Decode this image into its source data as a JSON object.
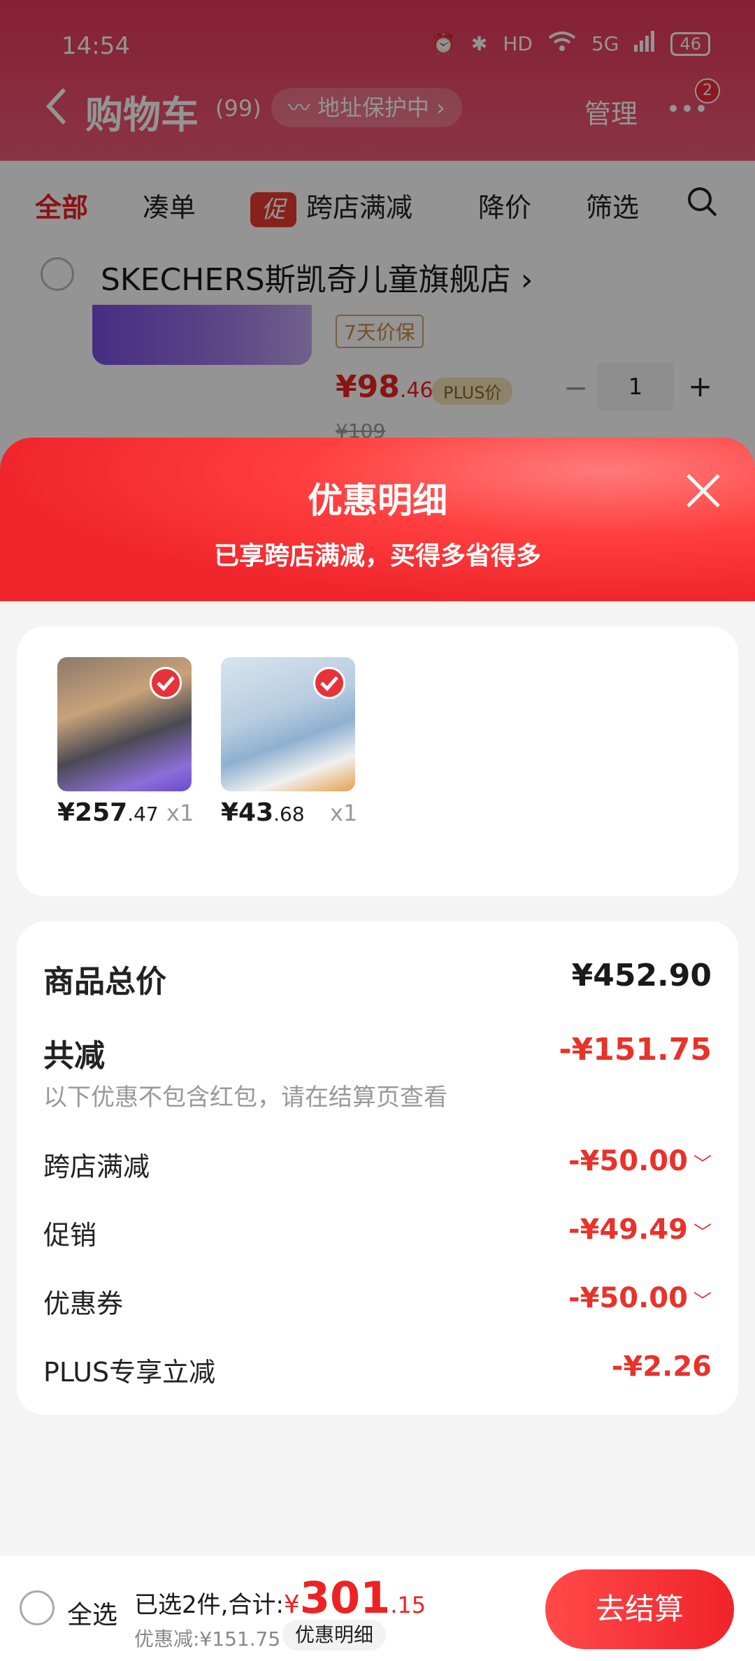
{
  "status_bar": {
    "time": "14:54",
    "battery": "46",
    "network": "5G",
    "hd": "HD"
  },
  "nav": {
    "title": "购物车",
    "count": "(99)",
    "address_pill": "地址保护中",
    "manage": "管理",
    "more_badge": "2"
  },
  "filters": {
    "all": "全部",
    "bundle": "凑单",
    "promo_chip": "促",
    "cross_store": "跨店满减",
    "price_drop": "降价",
    "filter": "筛选"
  },
  "store": {
    "name": "SKECHERS斯凯奇儿童旗舰店",
    "guarantee": "7天价保",
    "price_int": "¥98",
    "price_dec": ".46",
    "plus_tag": "PLUS价",
    "qty": "1",
    "old_price": "¥109"
  },
  "sheet": {
    "title": "优惠明细",
    "subtitle": "已享跨店满减，买得多省得多"
  },
  "products": [
    {
      "price_int": "¥257",
      "price_dec": ".47",
      "qty": "x1"
    },
    {
      "price_int": "¥43",
      "price_dec": ".68",
      "qty": "x1"
    }
  ],
  "summary": {
    "total_label": "商品总价",
    "total_value": "¥452.90",
    "reduce_label": "共减",
    "reduce_value": "-¥151.75",
    "note": "以下优惠不包含红包，请在结算页查看",
    "rows": [
      {
        "label": "跨店满减",
        "value": "-¥50.00"
      },
      {
        "label": "促销",
        "value": "-¥49.49"
      },
      {
        "label": "优惠券",
        "value": "-¥50.00"
      },
      {
        "label": "PLUS专享立减",
        "value": "-¥2.26"
      }
    ]
  },
  "bottom": {
    "select_all": "全选",
    "selected_text": "已选2件,合计:",
    "currency": "¥",
    "total_int": "301",
    "total_dec": ".15",
    "discount": "优惠减:¥151.75",
    "detail_chip": "优惠明细",
    "checkout": "去结算"
  },
  "colors": {
    "accent": "#e8322a",
    "header_gradient_start": "#e5395a",
    "sheet_header": "#f0262c"
  }
}
